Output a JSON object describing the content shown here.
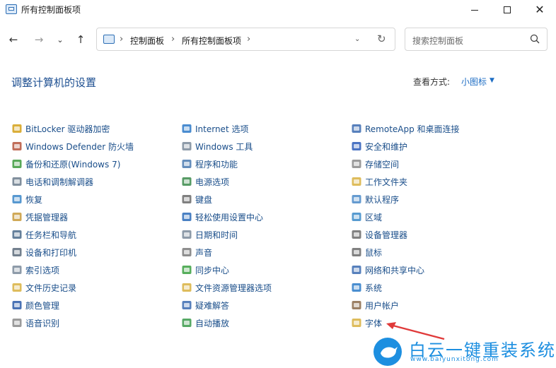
{
  "window": {
    "title": "所有控制面板项",
    "close_glyph": "✕"
  },
  "nav": {
    "back_glyph": "←",
    "forward_glyph": "→",
    "recent_glyph": "⌄",
    "up_glyph": "↑",
    "breadcrumb": [
      "控制面板",
      "所有控制面板项"
    ],
    "separator": "›",
    "dropdown_glyph": "⌄",
    "refresh_glyph": "↻",
    "search_placeholder": "搜索控制面板"
  },
  "header": {
    "title": "调整计算机的设置",
    "view_by_label": "查看方式:",
    "view_mode": "小图标",
    "view_caret": "▼"
  },
  "items": [
    [
      {
        "label": "BitLocker 驱动器加密",
        "icon": "bitlocker-icon",
        "color": "#d4a017"
      },
      {
        "label": "Windows Defender 防火墙",
        "icon": "firewall-icon",
        "color": "#b5533c"
      },
      {
        "label": "备份和还原(Windows 7)",
        "icon": "backup-icon",
        "color": "#3c9a3c"
      },
      {
        "label": "电话和调制解调器",
        "icon": "phone-modem-icon",
        "color": "#6b7b8c"
      },
      {
        "label": "恢复",
        "icon": "recovery-icon",
        "color": "#3a86c8"
      },
      {
        "label": "凭据管理器",
        "icon": "credential-icon",
        "color": "#c89a3a"
      },
      {
        "label": "任务栏和导航",
        "icon": "taskbar-icon",
        "color": "#4a6a8a"
      },
      {
        "label": "设备和打印机",
        "icon": "printer-icon",
        "color": "#5a6a7a"
      },
      {
        "label": "索引选项",
        "icon": "indexing-icon",
        "color": "#7a8a9a"
      },
      {
        "label": "文件历史记录",
        "icon": "file-history-icon",
        "color": "#d8b040"
      },
      {
        "label": "颜色管理",
        "icon": "color-management-icon",
        "color": "#2a5aa8"
      },
      {
        "label": "语音识别",
        "icon": "microphone-icon",
        "color": "#8a8a8a"
      }
    ],
    [
      {
        "label": "Internet 选项",
        "icon": "internet-options-icon",
        "color": "#2a78c8"
      },
      {
        "label": "Windows 工具",
        "icon": "windows-tools-icon",
        "color": "#7a8a9a"
      },
      {
        "label": "程序和功能",
        "icon": "programs-icon",
        "color": "#4a7ab0"
      },
      {
        "label": "电源选项",
        "icon": "power-icon",
        "color": "#3a8a4a"
      },
      {
        "label": "键盘",
        "icon": "keyboard-icon",
        "color": "#6a6a6a"
      },
      {
        "label": "轻松使用设置中心",
        "icon": "ease-of-access-icon",
        "color": "#2a6ab8"
      },
      {
        "label": "日期和时间",
        "icon": "clock-icon",
        "color": "#7a8a9a"
      },
      {
        "label": "声音",
        "icon": "speaker-icon",
        "color": "#7a7a7a"
      },
      {
        "label": "同步中心",
        "icon": "sync-icon",
        "color": "#3aa040"
      },
      {
        "label": "文件资源管理器选项",
        "icon": "folder-options-icon",
        "color": "#d8b040"
      },
      {
        "label": "疑难解答",
        "icon": "troubleshoot-icon",
        "color": "#3a6ab0"
      },
      {
        "label": "自动播放",
        "icon": "autoplay-icon",
        "color": "#3a9a4a"
      }
    ],
    [
      {
        "label": "RemoteApp 和桌面连接",
        "icon": "remoteapp-icon",
        "color": "#3a6ab0"
      },
      {
        "label": "安全和维护",
        "icon": "flag-icon",
        "color": "#2a5ab8"
      },
      {
        "label": "存储空间",
        "icon": "storage-icon",
        "color": "#8a8a8a"
      },
      {
        "label": "工作文件夹",
        "icon": "work-folders-icon",
        "color": "#d8b040"
      },
      {
        "label": "默认程序",
        "icon": "default-programs-icon",
        "color": "#4a8ac8"
      },
      {
        "label": "区域",
        "icon": "region-icon",
        "color": "#3a8ac8"
      },
      {
        "label": "设备管理器",
        "icon": "device-manager-icon",
        "color": "#6a6a6a"
      },
      {
        "label": "鼠标",
        "icon": "mouse-icon",
        "color": "#6a6a6a"
      },
      {
        "label": "网络和共享中心",
        "icon": "network-icon",
        "color": "#3a6ab0"
      },
      {
        "label": "系统",
        "icon": "system-icon",
        "color": "#2a7ac8"
      },
      {
        "label": "用户帐户",
        "icon": "user-accounts-icon",
        "color": "#8a6a4a"
      },
      {
        "label": "字体",
        "icon": "font-icon",
        "color": "#d8b040"
      }
    ]
  ],
  "watermark": {
    "text": "白云一键重装系统",
    "url": "www.baiyunxitong.com"
  },
  "accent": {
    "link": "#1a4e8a",
    "heading": "#1d4f91",
    "arrow": "#e03a3a"
  }
}
